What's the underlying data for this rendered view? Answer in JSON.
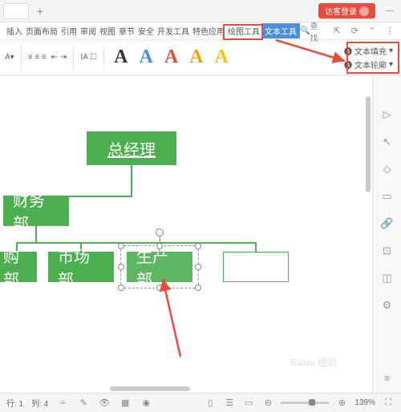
{
  "titlebar": {
    "login": "访客登录"
  },
  "menu": {
    "items": [
      "插入",
      "页面布局",
      "引用",
      "审阅",
      "视图",
      "章节",
      "安全",
      "开发工具",
      "特色应用",
      "绘图工具",
      "文本工具"
    ],
    "search": "查找"
  },
  "toolbar": {
    "text_fill": "文本填充",
    "text_outline": "文本轮廓"
  },
  "org": {
    "ceo": "总经理",
    "finance": "财务部",
    "purchase": "购部",
    "marketing": "市场部",
    "production": "生产部"
  },
  "status": {
    "row_label": "行: 1",
    "col_label": "列: 4",
    "zoom": "139%"
  },
  "watermark": "Baidu 经验"
}
